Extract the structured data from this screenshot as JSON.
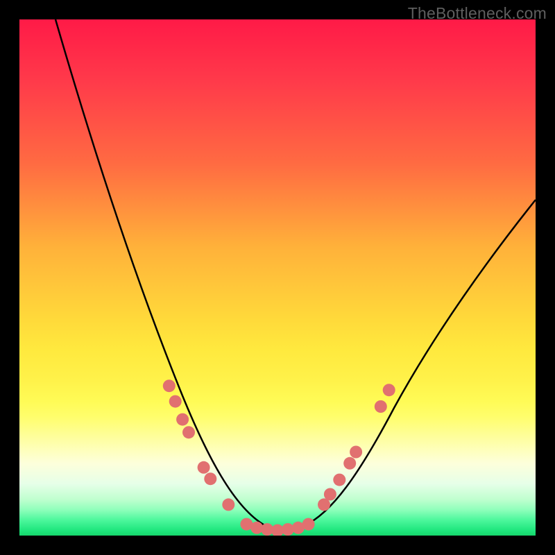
{
  "watermark": "TheBottleneck.com",
  "chart_data": {
    "type": "line",
    "title": "",
    "xlabel": "",
    "ylabel": "",
    "xlim": [
      0,
      1
    ],
    "ylim": [
      0,
      1
    ],
    "curve_approx": [
      {
        "x": 0.07,
        "y": 1.0
      },
      {
        "x": 0.12,
        "y": 0.82
      },
      {
        "x": 0.18,
        "y": 0.62
      },
      {
        "x": 0.24,
        "y": 0.43
      },
      {
        "x": 0.29,
        "y": 0.29
      },
      {
        "x": 0.34,
        "y": 0.17
      },
      {
        "x": 0.38,
        "y": 0.09
      },
      {
        "x": 0.42,
        "y": 0.04
      },
      {
        "x": 0.46,
        "y": 0.015
      },
      {
        "x": 0.5,
        "y": 0.01
      },
      {
        "x": 0.54,
        "y": 0.015
      },
      {
        "x": 0.58,
        "y": 0.045
      },
      {
        "x": 0.62,
        "y": 0.1
      },
      {
        "x": 0.68,
        "y": 0.21
      },
      {
        "x": 0.76,
        "y": 0.36
      },
      {
        "x": 0.86,
        "y": 0.52
      },
      {
        "x": 0.96,
        "y": 0.64
      },
      {
        "x": 1.0,
        "y": 0.68
      }
    ],
    "markers_left": [
      {
        "x": 0.29,
        "y": 0.29
      },
      {
        "x": 0.302,
        "y": 0.26
      },
      {
        "x": 0.316,
        "y": 0.225
      },
      {
        "x": 0.328,
        "y": 0.2
      },
      {
        "x": 0.357,
        "y": 0.132
      },
      {
        "x": 0.37,
        "y": 0.11
      },
      {
        "x": 0.405,
        "y": 0.06
      }
    ],
    "markers_bottom": [
      {
        "x": 0.44,
        "y": 0.022
      },
      {
        "x": 0.46,
        "y": 0.015
      },
      {
        "x": 0.48,
        "y": 0.012
      },
      {
        "x": 0.5,
        "y": 0.01
      },
      {
        "x": 0.52,
        "y": 0.012
      },
      {
        "x": 0.54,
        "y": 0.015
      },
      {
        "x": 0.56,
        "y": 0.022
      }
    ],
    "markers_right": [
      {
        "x": 0.59,
        "y": 0.06
      },
      {
        "x": 0.602,
        "y": 0.08
      },
      {
        "x": 0.62,
        "y": 0.108
      },
      {
        "x": 0.64,
        "y": 0.14
      },
      {
        "x": 0.652,
        "y": 0.162
      },
      {
        "x": 0.7,
        "y": 0.25
      },
      {
        "x": 0.716,
        "y": 0.282
      }
    ],
    "marker_color": "#e17070",
    "curve_color": "#000000",
    "background_gradient": [
      "#ff1a47",
      "#ffd93a",
      "#fffb56",
      "#16d66c"
    ]
  }
}
